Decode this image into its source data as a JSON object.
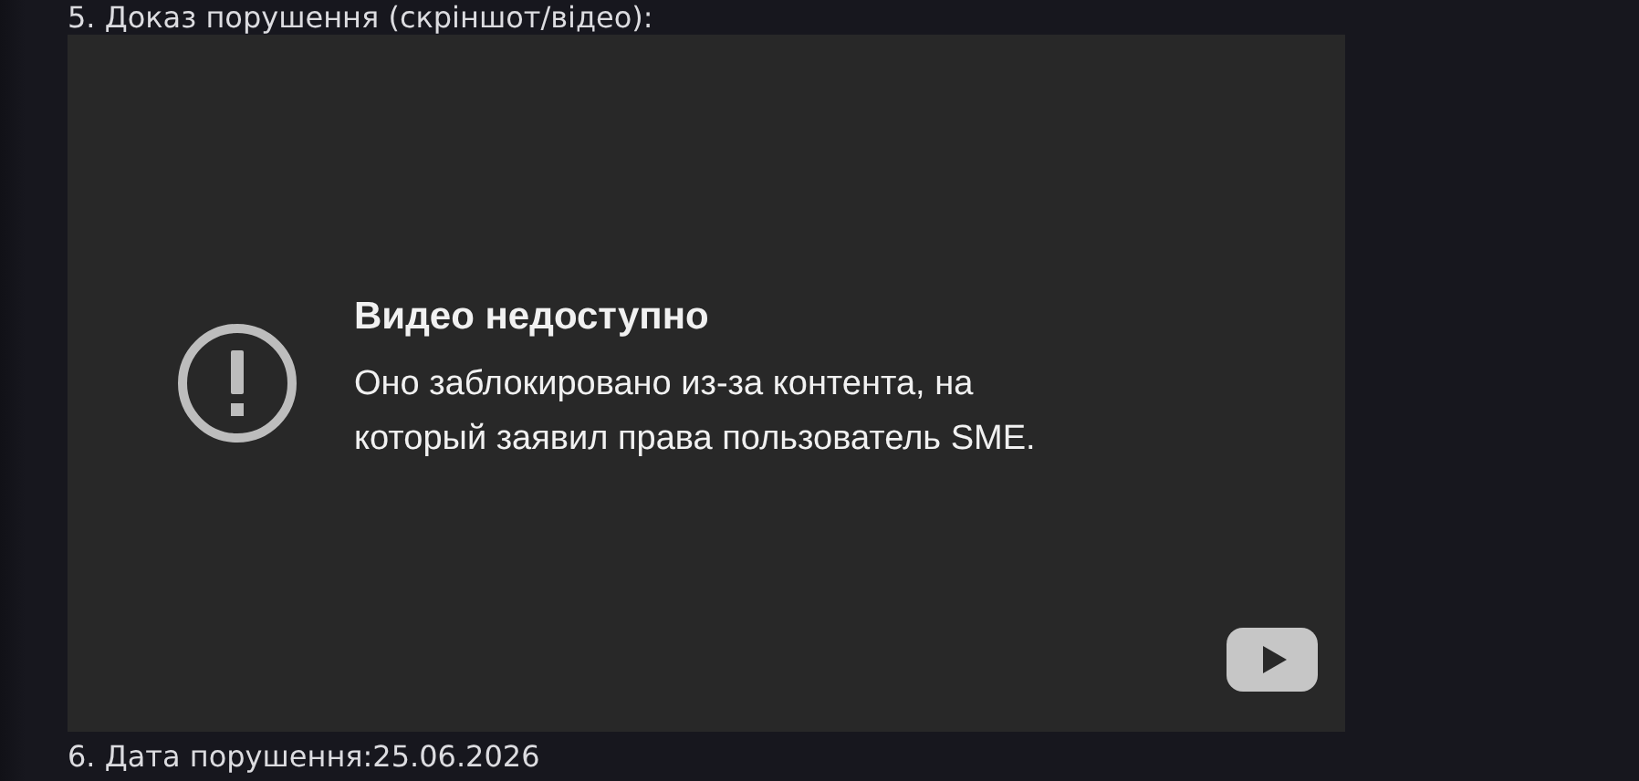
{
  "post": {
    "step_5_label": "5. Доказ порушення (скріншот/відео):",
    "video": {
      "error_title": "Видео недоступно",
      "error_message": "Оно заблокировано из-за контента, на который заявил права пользователь SME."
    },
    "step_6_label": "6. Дата порушення:25.06.2026"
  }
}
